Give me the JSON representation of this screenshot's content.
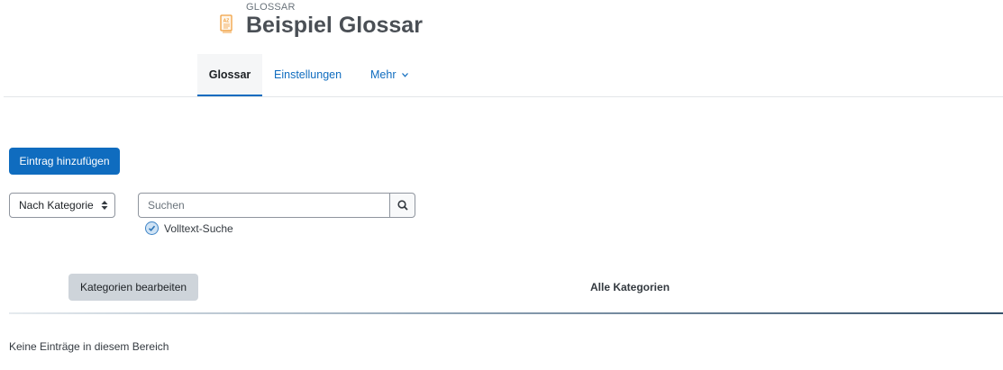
{
  "header": {
    "subtitle": "GLOSSAR",
    "title": "Beispiel Glossar",
    "icon": "glossary-book-icon"
  },
  "nav": {
    "tabs": [
      {
        "label": "Glossar",
        "active": true
      },
      {
        "label": "Einstellungen",
        "active": false
      },
      {
        "label": "Mehr",
        "active": false,
        "icon": "chevron-down-icon"
      }
    ]
  },
  "actions": {
    "add_entry_label": "Eintrag hinzufügen"
  },
  "filter": {
    "browse_mode_selected": "Nach Kategorie"
  },
  "search": {
    "placeholder": "Suchen",
    "value": "",
    "fulltext_label": "Volltext-Suche",
    "fulltext_checked": true
  },
  "categories": {
    "edit_label": "Kategorien bearbeiten",
    "heading": "Alle Kategorien"
  },
  "content": {
    "empty_message": "Keine Einträge in diesem Bereich"
  },
  "colors": {
    "primary": "#0f6cbf",
    "secondary_button": "#ced4da",
    "icon_orange": "#f0a040"
  }
}
